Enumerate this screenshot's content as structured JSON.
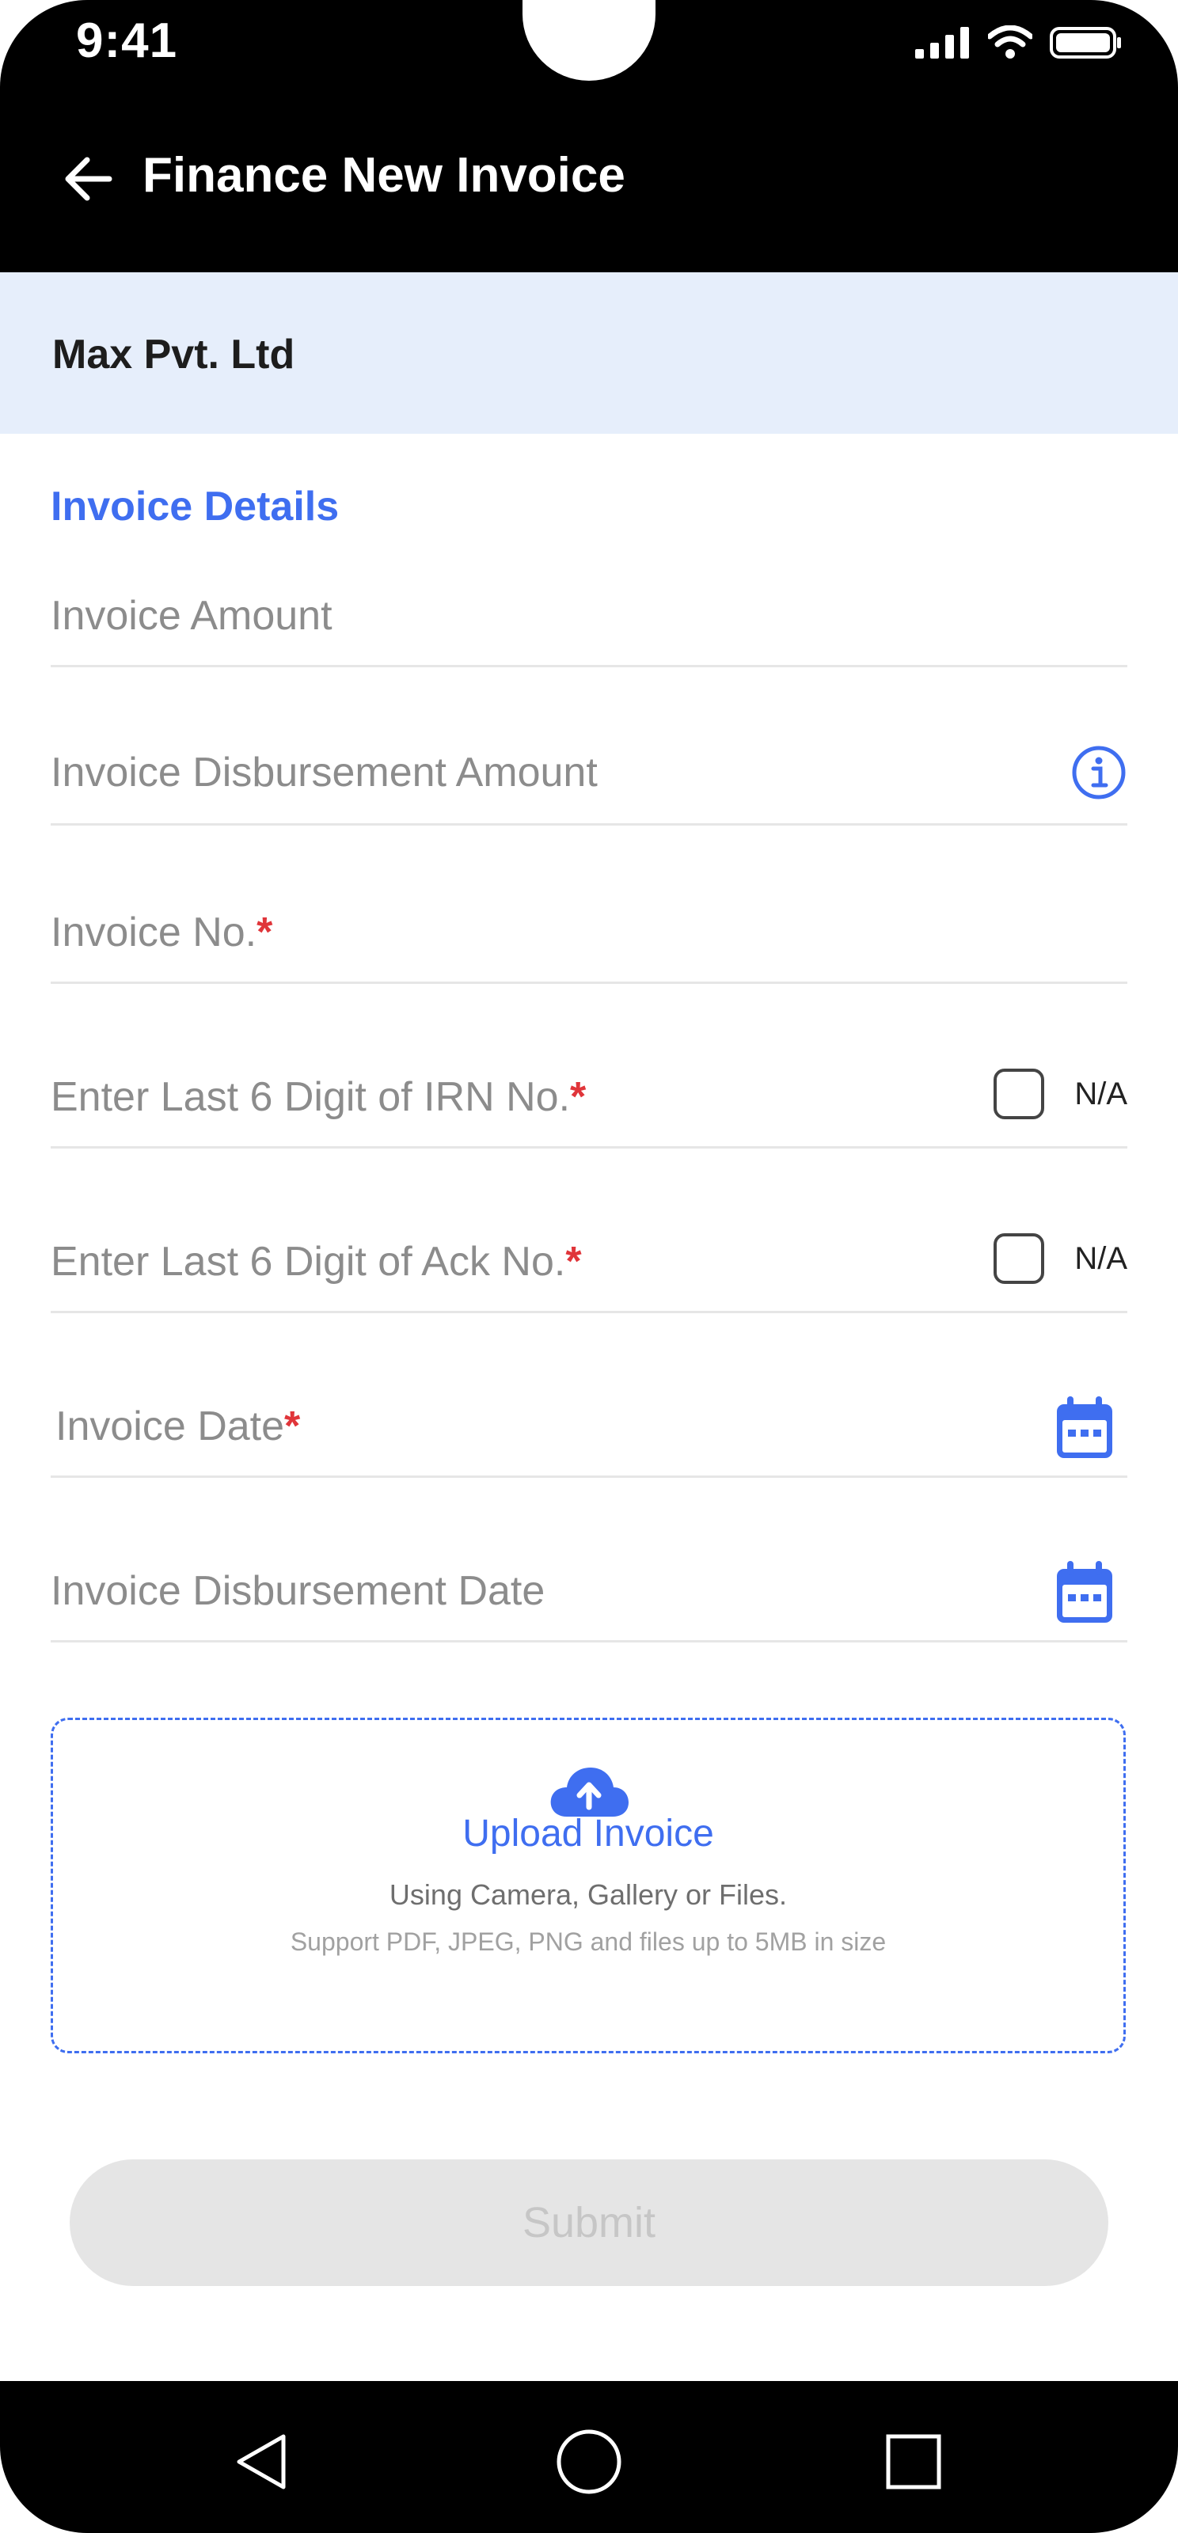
{
  "status_bar": {
    "time": "9:41"
  },
  "app_bar": {
    "title": "Finance New Invoice"
  },
  "company": {
    "name": "Max Pvt. Ltd"
  },
  "section": {
    "title": "Invoice Details"
  },
  "fields": {
    "invoice_amount": {
      "label": "Invoice Amount"
    },
    "disbursement_amount": {
      "label": "Invoice Disbursement Amount"
    },
    "invoice_no": {
      "label": "Invoice No.",
      "required": "*"
    },
    "irn": {
      "label": "Enter Last 6 Digit of IRN No.",
      "required": "*",
      "na_label": "N/A"
    },
    "ack": {
      "label": "Enter Last 6 Digit of Ack No.",
      "required": "*",
      "na_label": "N/A"
    },
    "invoice_date": {
      "label": "Invoice Date",
      "required": "*"
    },
    "disbursement_date": {
      "label": "Invoice Disbursement Date"
    }
  },
  "upload": {
    "title": "Upload Invoice",
    "subtitle": "Using Camera, Gallery or Files.",
    "note": "Support PDF, JPEG, PNG and files up to 5MB in size"
  },
  "submit": {
    "label": "Submit"
  },
  "colors": {
    "accent": "#3f6ef0",
    "required": "#e0353a",
    "banner": "#e6eefb",
    "disabled": "#e5e5e5"
  }
}
